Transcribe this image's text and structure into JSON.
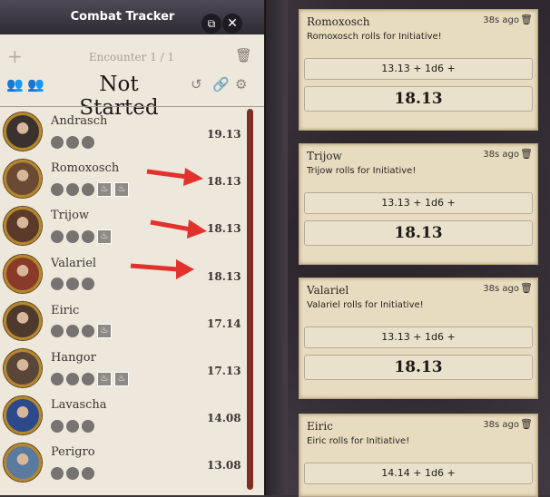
{
  "tracker": {
    "title": "Combat Tracker",
    "encounter_label": "Encounter 1 / 1",
    "status": "Not Started",
    "combatants": [
      {
        "name": "Andrasch",
        "initiative": "19.13",
        "badges": 0,
        "portrait_color": "#3b3230"
      },
      {
        "name": "Romoxosch",
        "initiative": "18.13",
        "badges": 2,
        "portrait_color": "#6b4a35"
      },
      {
        "name": "Trijow",
        "initiative": "18.13",
        "badges": 1,
        "portrait_color": "#5b3a2a"
      },
      {
        "name": "Valariel",
        "initiative": "18.13",
        "badges": 0,
        "portrait_color": "#8a3a28"
      },
      {
        "name": "Eiric",
        "initiative": "17.14",
        "badges": 1,
        "portrait_color": "#4e3a2c"
      },
      {
        "name": "Hangor",
        "initiative": "17.13",
        "badges": 2,
        "portrait_color": "#5a4638"
      },
      {
        "name": "Lavascha",
        "initiative": "14.08",
        "badges": 0,
        "portrait_color": "#2c4a8a"
      },
      {
        "name": "Perigro",
        "initiative": "13.08",
        "badges": 0,
        "portrait_color": "#5a7aa0"
      }
    ]
  },
  "chat": {
    "messages": [
      {
        "speaker": "Romoxosch",
        "time": "38s ago",
        "flavor": "Romoxosch rolls for Initiative!",
        "formula": "13.13 + 1d6 +",
        "total": "18.13"
      },
      {
        "speaker": "Trijow",
        "time": "38s ago",
        "flavor": "Trijow rolls for Initiative!",
        "formula": "13.13 + 1d6 +",
        "total": "18.13"
      },
      {
        "speaker": "Valariel",
        "time": "38s ago",
        "flavor": "Valariel rolls for Initiative!",
        "formula": "13.13 + 1d6 +",
        "total": "18.13"
      },
      {
        "speaker": "Eiric",
        "time": "38s ago",
        "flavor": "Eiric rolls for Initiative!",
        "formula": "14.14 + 1d6 +",
        "total": ""
      }
    ]
  },
  "colors": {
    "accent": "#7a3024",
    "arrow": "#e0332e",
    "portrait_ring": "#b5872d"
  }
}
